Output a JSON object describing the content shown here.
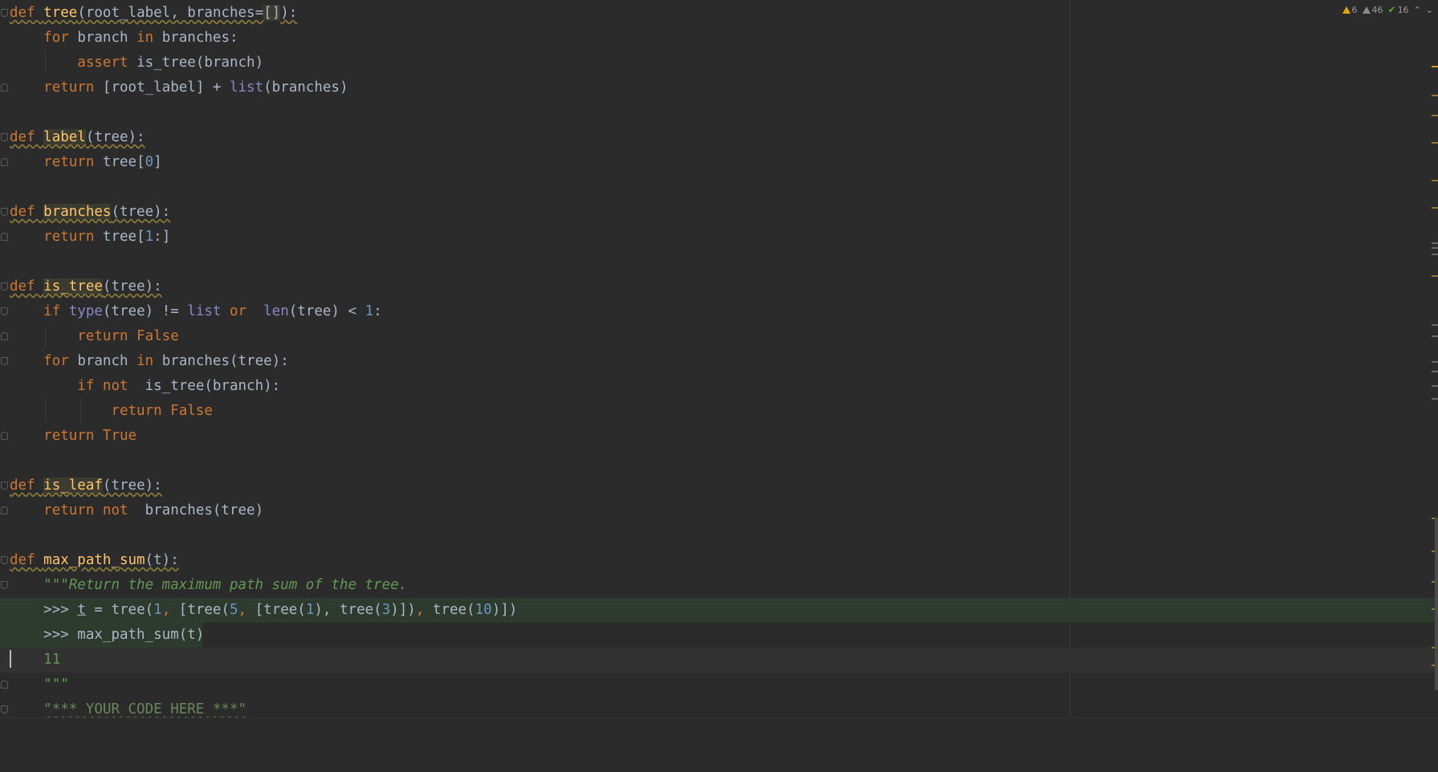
{
  "inspections": {
    "errors": "6",
    "warnings": "46",
    "ok": "16"
  },
  "code": {
    "l1": {
      "def": "def ",
      "name": "tree",
      "params": "(root_label, branches=",
      "brk": "[]",
      "close": "):"
    },
    "l2": {
      "kw1": "for ",
      "a": "branch ",
      "kw2": "in ",
      "b": "branches:"
    },
    "l3": {
      "kw": "assert ",
      "a": "is_tree(branch)"
    },
    "l4": {
      "kw": "return ",
      "a": "[root_label] + ",
      "bi": "list",
      "b": "(branches)"
    },
    "l6": {
      "def": "def ",
      "name": "label",
      "rest": "(tree):"
    },
    "l7": {
      "kw": "return ",
      "a": "tree[",
      "n": "0",
      "b": "]"
    },
    "l9": {
      "def": "def ",
      "name": "branches",
      "rest": "(tree):"
    },
    "l10": {
      "kw": "return ",
      "a": "tree[",
      "n": "1",
      "b": ":]"
    },
    "l12": {
      "def": "def ",
      "name": "is_tree",
      "rest": "(tree):"
    },
    "l13": {
      "kw1": "if ",
      "bi1": "type",
      "a": "(tree) != ",
      "bi2": "list",
      "kw2": " or ",
      "bi3": "len",
      "b": "(tree) < ",
      "n": "1",
      "c": ":"
    },
    "l14": {
      "kw": "return False"
    },
    "l15": {
      "kw1": "for ",
      "a": "branch ",
      "kw2": "in ",
      "b": "branches(tree):"
    },
    "l16": {
      "kw": "if not ",
      "a": "is_tree(branch):"
    },
    "l17": {
      "kw": "return False"
    },
    "l18": {
      "kw": "return True"
    },
    "l20": {
      "def": "def ",
      "name": "is_leaf",
      "rest": "(tree):"
    },
    "l21": {
      "kw": "return not ",
      "a": "branches(tree)"
    },
    "l23": {
      "def": "def ",
      "name": "max_path_sum",
      "rest": "(t):"
    },
    "l24": {
      "doc": "\"\"\"Return the maximum path sum of the tree."
    },
    "l25": {
      "p": ">>> ",
      "t": "t",
      "a": " = tree(",
      "n1": "1",
      "c1": ", ",
      "b": "[tree(",
      "n2": "5",
      "c2": ", ",
      "c": "[tree(",
      "n3": "1",
      "d": "), tree(",
      "n4": "3",
      "e": ")])",
      "c3": ", ",
      "f": "tree(",
      "n5": "10",
      "g": ")])"
    },
    "l26": {
      "a": ">>> max_path_sum(t)"
    },
    "l27": {
      "a": "11"
    },
    "l28": {
      "a": "\"\"\""
    },
    "l29": {
      "a": "\"*** YOUR CODE HERE ***\""
    }
  }
}
